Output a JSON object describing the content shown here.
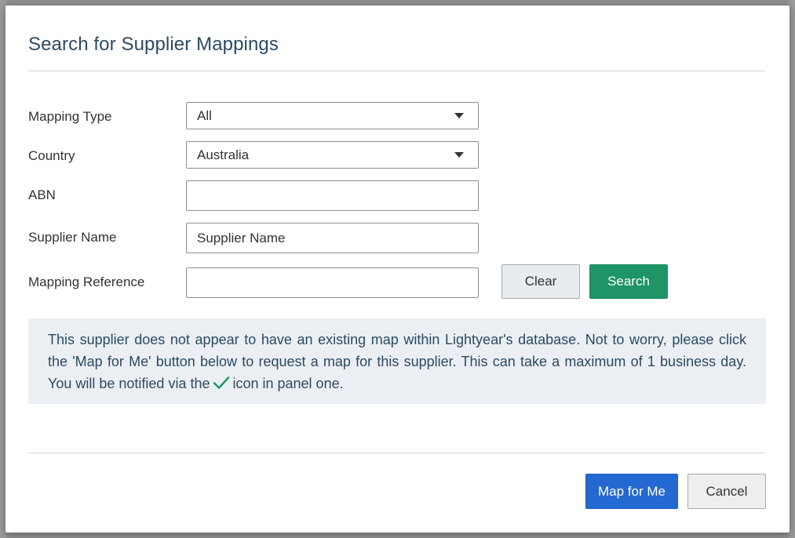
{
  "dialog": {
    "title": "Search for Supplier Mappings"
  },
  "form": {
    "mapping_type": {
      "label": "Mapping Type",
      "value": "All"
    },
    "country": {
      "label": "Country",
      "value": "Australia"
    },
    "abn": {
      "label": "ABN",
      "value": ""
    },
    "supplier_name": {
      "label": "Supplier Name",
      "value": "Supplier Name"
    },
    "mapping_reference": {
      "label": "Mapping Reference",
      "value": ""
    },
    "clear_label": "Clear",
    "search_label": "Search"
  },
  "notice": {
    "text_before_icon": "This supplier does not appear to have an existing map within Lightyear's database. Not to worry, please click the 'Map for Me' button below to request a map for this supplier. This can take a maximum of 1 business day. You will be notified via the",
    "icon": "check-icon",
    "text_after_icon": "icon in panel one."
  },
  "footer": {
    "map_label": "Map for Me",
    "cancel_label": "Cancel"
  },
  "colors": {
    "title": "#2c4a63",
    "search_button": "#1f9466",
    "primary_button": "#2468d1",
    "notice_bg": "#ebeff3",
    "check_icon": "#1f9466"
  }
}
